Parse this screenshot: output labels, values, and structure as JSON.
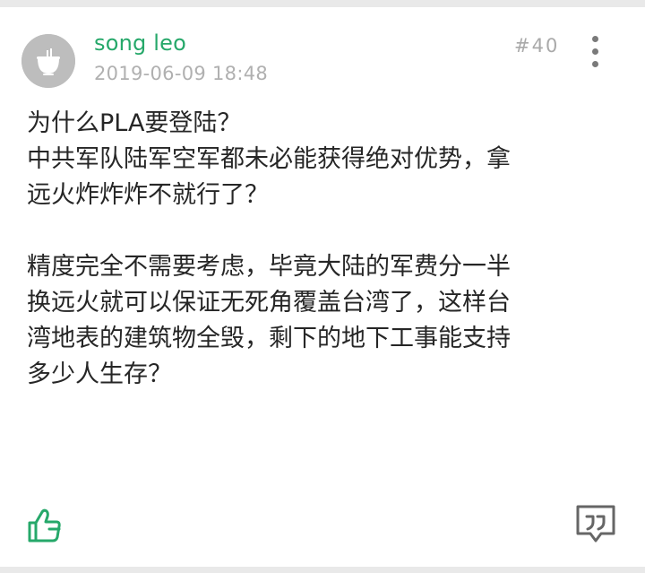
{
  "post": {
    "author": "song leo",
    "timestamp": "2019-06-09 18:48",
    "floor": "#40",
    "content_lines": [
      "为什么PLA要登陆？",
      "中共军队陆军空军都未必能获得绝对优势，拿",
      "远火炸炸炸不就行了？",
      "",
      "精度完全不需要考虑，毕竟大陆的军费分一半",
      "换远火就可以保证无死角覆盖台湾了，这样台",
      "湾地表的建筑物全毁，剩下的地下工事能支持",
      "多少人生存？"
    ]
  },
  "icons": {
    "avatar": "avatar-icon",
    "more": "more-vertical-icon",
    "like": "thumbs-up-icon",
    "quote_reply": "quote-reply-icon"
  },
  "colors": {
    "author": "#26a86a",
    "like_icon": "#26a86a",
    "meta": "#b0b0b0",
    "text": "#262626"
  }
}
